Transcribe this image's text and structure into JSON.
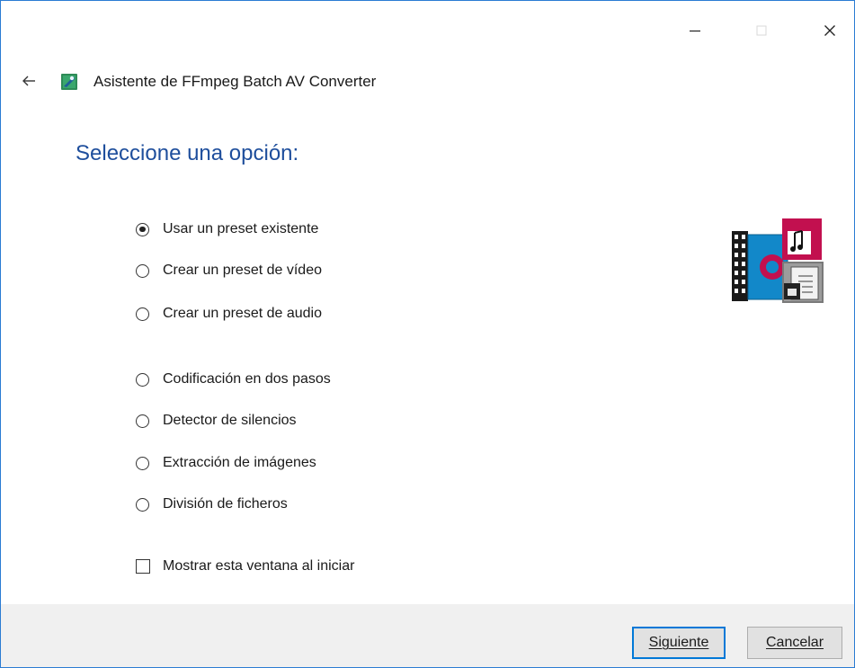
{
  "window": {
    "title": "Asistente de FFmpeg Batch AV Converter",
    "accent_color": "#2b7cd3",
    "caption_buttons": [
      "minimize-icon",
      "maximize-icon",
      "close-icon"
    ]
  },
  "main": {
    "heading": "Seleccione una opción:",
    "heading_color": "#1e4e9c",
    "options": [
      {
        "label": "Usar un preset existente",
        "selected": true
      },
      {
        "label": "Crear un preset de vídeo",
        "selected": false
      },
      {
        "label": "Crear un preset de audio",
        "selected": false
      },
      {
        "label": "Codificación en dos pasos",
        "selected": false
      },
      {
        "label": "Detector de silencios",
        "selected": false
      },
      {
        "label": "Extracción de imágenes",
        "selected": false
      },
      {
        "label": "División de ficheros",
        "selected": false
      }
    ],
    "startup_checkbox": {
      "label": "Mostrar esta ventana al iniciar",
      "checked": false
    },
    "graphic": "media-conversion-illustration"
  },
  "footer": {
    "next_label": "Siguiente",
    "cancel_label": "Cancelar"
  }
}
